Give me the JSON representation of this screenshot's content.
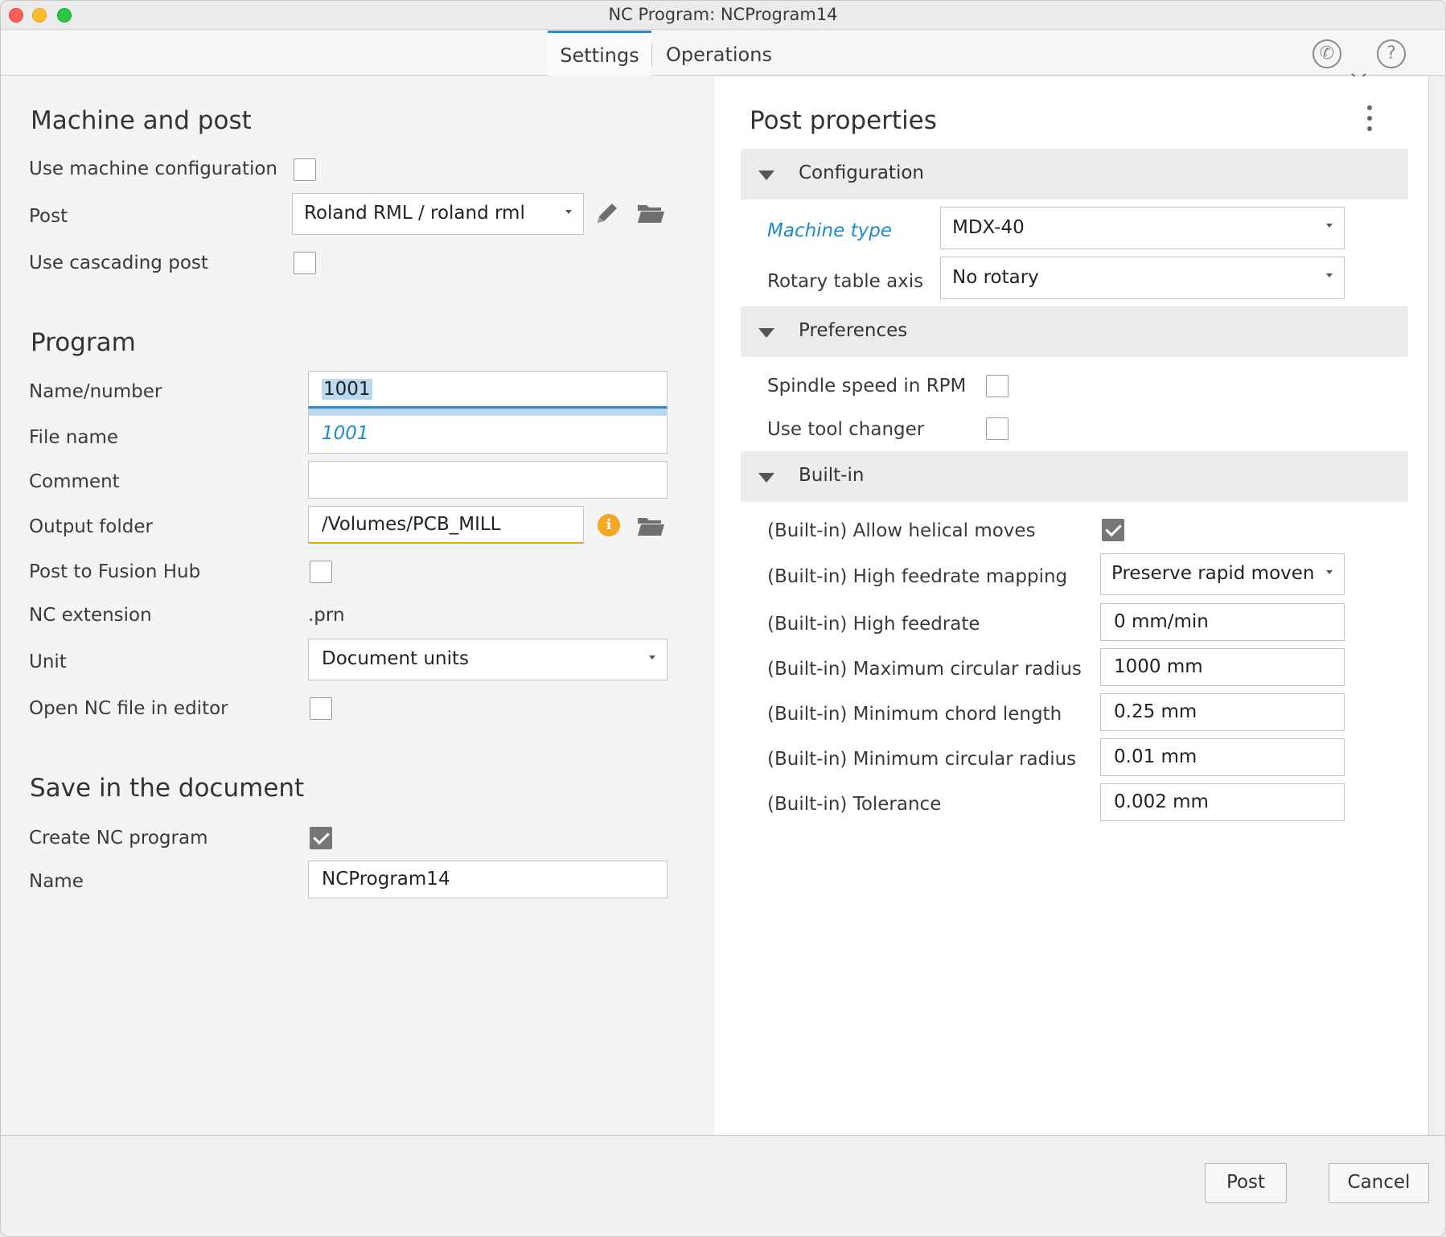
{
  "window": {
    "title": "NC Program: NCProgram14"
  },
  "tabs": [
    {
      "label": "Settings",
      "active": true
    },
    {
      "label": "Operations",
      "active": false
    }
  ],
  "header_icons": [
    "support-phone-icon",
    "chevron-down-icon",
    "help-icon"
  ],
  "header_icon_glyphs": {
    "help": "?",
    "phone": "✆"
  },
  "left": {
    "machine_section": {
      "title": "Machine and post",
      "use_machine_config_label": "Use machine configuration",
      "use_machine_config_checked": false,
      "post_label": "Post",
      "post_value": "Roland RML / roland rml",
      "use_cascading_label": "Use cascading post",
      "use_cascading_checked": false
    },
    "program_section": {
      "title": "Program",
      "name_number_label": "Name/number",
      "name_number_value": "1001",
      "file_name_label": "File name",
      "file_name_value": "1001",
      "comment_label": "Comment",
      "comment_value": "",
      "output_folder_label": "Output folder",
      "output_folder_value": "/Volumes/PCB_MILL",
      "post_to_hub_label": "Post to Fusion Hub",
      "post_to_hub_checked": false,
      "nc_extension_label": "NC extension",
      "nc_extension_value": ".prn",
      "unit_label": "Unit",
      "unit_value": "Document units",
      "open_in_editor_label": "Open NC file in editor",
      "open_in_editor_checked": false
    },
    "save_section": {
      "title": "Save in the document",
      "create_nc_label": "Create NC program",
      "create_nc_checked": true,
      "name_label": "Name",
      "name_value": "NCProgram14"
    }
  },
  "right": {
    "title": "Post properties",
    "groups": {
      "configuration": {
        "label": "Configuration",
        "machine_type_label": "Machine type",
        "machine_type_value": "MDX-40",
        "rotary_axis_label": "Rotary table axis",
        "rotary_axis_value": "No rotary"
      },
      "preferences": {
        "label": "Preferences",
        "spindle_rpm_label": "Spindle speed in RPM",
        "spindle_rpm_checked": false,
        "tool_changer_label": "Use tool changer",
        "tool_changer_checked": false
      },
      "builtin": {
        "label": "Built-in",
        "helical_label": "(Built-in) Allow helical moves",
        "helical_checked": true,
        "high_feed_mapping_label": "(Built-in) High feedrate mapping",
        "high_feed_mapping_value": "Preserve rapid moven",
        "high_feedrate_label": "(Built-in) High feedrate",
        "high_feedrate_value": "0 mm/min",
        "max_circ_radius_label": "(Built-in) Maximum circular radius",
        "max_circ_radius_value": "1000 mm",
        "min_chord_label": "(Built-in) Minimum chord length",
        "min_chord_value": "0.25 mm",
        "min_circ_radius_label": "(Built-in) Minimum circular radius",
        "min_circ_radius_value": "0.01 mm",
        "tolerance_label": "(Built-in) Tolerance",
        "tolerance_value": "0.002 mm"
      }
    }
  },
  "footer": {
    "post_label": "Post",
    "cancel_label": "Cancel"
  },
  "colors": {
    "accent": "#2a8ad4",
    "link": "#1f8ac9",
    "warning": "#f5a623"
  }
}
